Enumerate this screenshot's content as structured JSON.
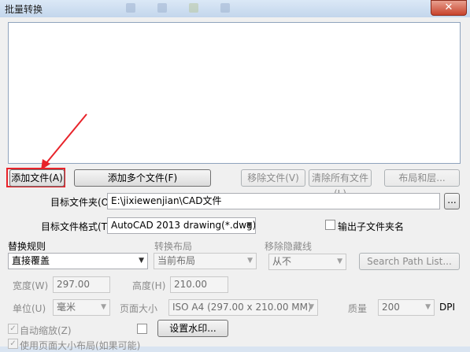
{
  "window": {
    "title": "批量转换",
    "close_label": "✕"
  },
  "files": {
    "add_file": "添加文件(A)",
    "add_multiple": "添加多个文件(F)",
    "remove_file": "移除文件(V)",
    "clear_all": "清除所有文件(L)",
    "layouts": "布局和层..."
  },
  "target_folder": {
    "label": "目标文件夹(O)",
    "value": "E:\\jixiewenjian\\CAD文件",
    "browse": "..."
  },
  "target_format": {
    "label": "目标文件格式(T)",
    "value": "AutoCAD 2013 drawing(*.dwg)",
    "output_subfolder": "输出子文件夹名"
  },
  "replace_rule": {
    "label": "替换规则",
    "value": "直接覆盖"
  },
  "convert_layout": {
    "label": "转换布局",
    "value": "当前布局"
  },
  "remove_hidden": {
    "label": "移除隐藏线",
    "value": "从不"
  },
  "search_path": "Search Path List...",
  "width": {
    "label": "宽度(W)",
    "value": "297.00"
  },
  "height": {
    "label": "高度(H)",
    "value": "210.00"
  },
  "unit": {
    "label": "单位(U)",
    "value": "毫米"
  },
  "page_size": {
    "label": "页面大小",
    "value": "ISO A4 (297.00 x 210.00 MM)"
  },
  "quality": {
    "label": "质量",
    "value": "200",
    "unit": "DPI"
  },
  "auto_zoom": {
    "label": "自动缩放(Z)",
    "check": "✓"
  },
  "watermark": "设置水印...",
  "use_page_layout": {
    "label": "使用页面大小布局(如果可能)",
    "check": "✓"
  }
}
